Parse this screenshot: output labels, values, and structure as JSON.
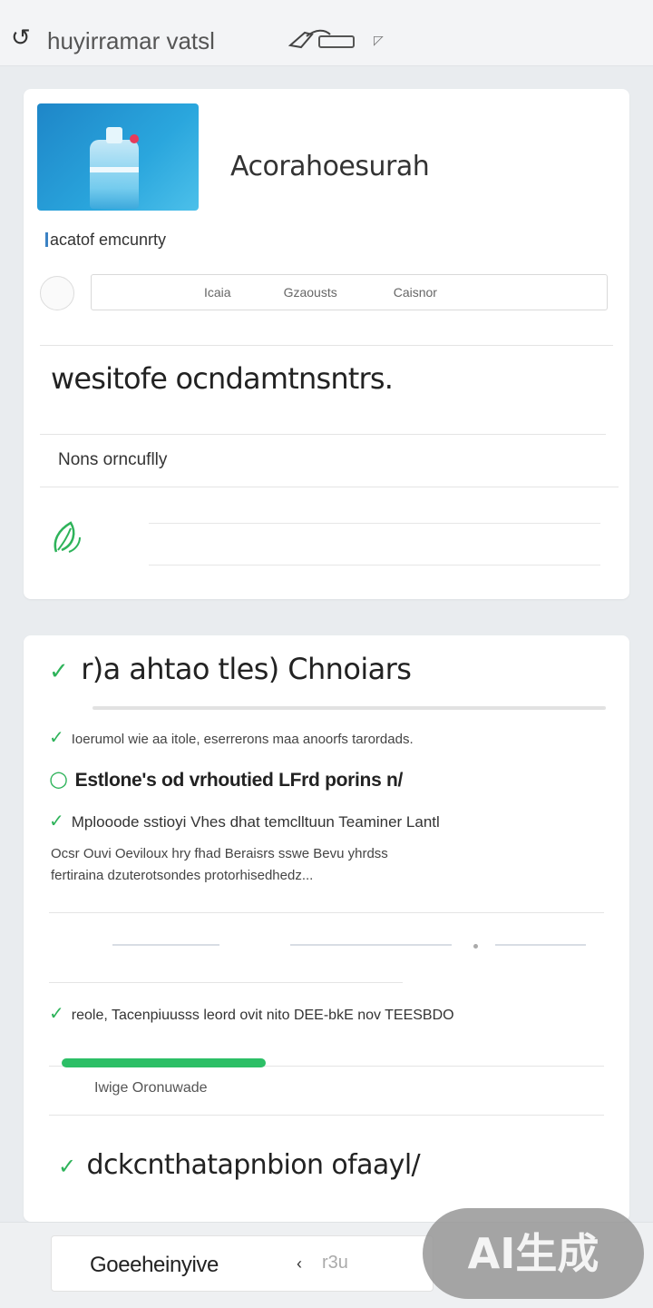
{
  "header": {
    "title": "huyirramar vatsl",
    "back_icon": "back-icon",
    "pen_icon": "pen-icon"
  },
  "card1": {
    "hero_title": "Acorahoesurah",
    "subtitle": "acatof emcunrty",
    "segments": [
      "Icaia",
      "Gzaousts",
      "Caisnor"
    ],
    "heading": "wesitofe ocndamtnsntrs.",
    "row_text": "Nons orncuflly",
    "leaf_icon": "leaf-icon"
  },
  "card2": {
    "heading": "r)a ahtao tles) Chnoiars",
    "items": [
      "Ioerumol wie aa itole, eserrerons maa anoorfs tarordads.",
      "Estlone's od vrhoutied LFrd porins n/",
      "Mplooode sstioyi Vhes dhat temclltuun Teaminer Lantl"
    ],
    "paragraph": [
      "Ocsr Ouvi Oeviloux hry fhad Beraisrs sswe Bevu yhrdss",
      "fertiraina dzuterotsondes protorhisedhedz..."
    ],
    "link_line": "reole, Tacenpiuusss leord ovit nito DEE-bkE nov TEESBDO",
    "progress_label": "Iwige Oronuwade",
    "progress_fraction": 0.45,
    "final_text": "dckcnthatapnbion ofaayl/"
  },
  "bottom": {
    "button_label": "Goeeheinyive",
    "arrow": "‹",
    "hint": "r3u"
  },
  "watermark": "AI生成",
  "colors": {
    "accent_green": "#2cbf66",
    "check_green": "#2eb35a",
    "link_blue": "#3b82c4"
  }
}
